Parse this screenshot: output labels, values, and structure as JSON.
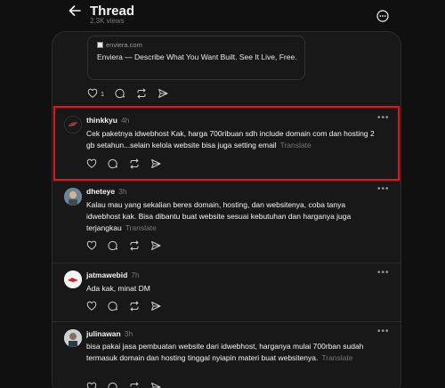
{
  "header": {
    "title": "Thread",
    "views": "2.3K views"
  },
  "link_card": {
    "domain": "enviera.com",
    "title": "Enviera — Describe What You Want Built. See It Live, Free."
  },
  "top_actions": {
    "like_count": "1"
  },
  "posts": [
    {
      "username": "thinkkyu",
      "time": "4h",
      "text": "Cek paketnya idwebhost Kak, harga 700ribuan sdh include domain com dan hosting 2 gb setahun...selain kelola website bisa juga setting email",
      "translate": "Translate"
    },
    {
      "username": "dheteye",
      "time": "3h",
      "text": "Kalau mau yang sekalian beres domain, hosting, dan websitenya, coba tanya idwebhost kak. Bisa dibantu buat website sesuai kebutuhan dan harganya juga terjangkau",
      "translate": "Translate"
    },
    {
      "username": "jatmawebid",
      "time": "7h",
      "text": "Ada kak, minat DM",
      "translate": ""
    },
    {
      "username": "julinawan",
      "time": "3h",
      "text": "bisa pakai jasa pembuatan website dari idwebhost, harganya mulai 700rban sudah termasuk domain dan hosting tinggal nyiapin materi buat websitenya.",
      "translate": "Translate"
    }
  ],
  "icons": {
    "back": "arrow-left-icon",
    "more": "more-circle-icon",
    "like": "heart-icon",
    "reply": "comment-icon",
    "repost": "repost-icon",
    "share": "send-icon"
  },
  "colors": {
    "background": "#101010",
    "panel": "#181818",
    "highlight": "#e0141c"
  }
}
